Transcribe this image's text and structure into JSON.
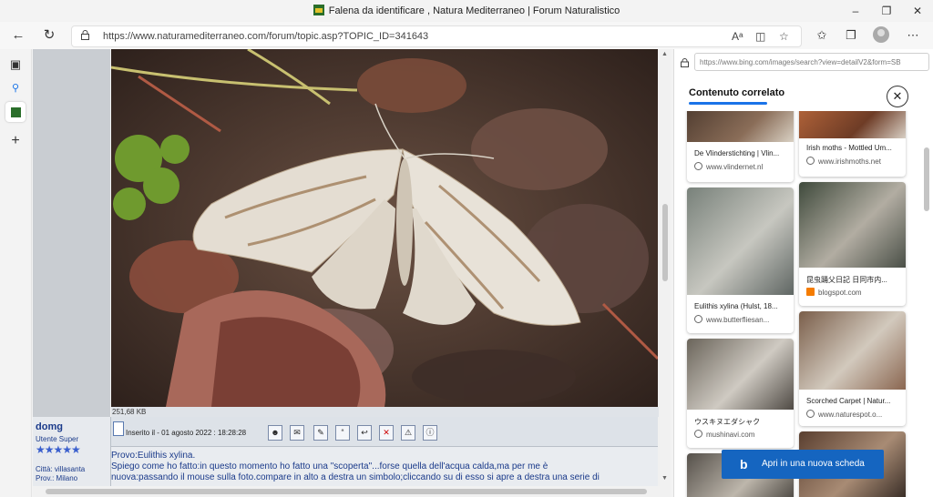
{
  "window": {
    "title": "Falena da identificare , Natura Mediterraneo | Forum Naturalistico",
    "minimize_glyph": "–",
    "maximize_glyph": "❐",
    "close_glyph": "✕"
  },
  "address_bar": {
    "url": "https://www.naturamediterraneo.com/forum/topic.asp?TOPIC_ID=341643",
    "back_glyph": "←",
    "refresh_glyph": "↻"
  },
  "post": {
    "image_size": "251,68 KB",
    "author": "domg",
    "rank": "Utente Super",
    "stars": "★★★★★",
    "city": "Città: villasanta",
    "prov": "Prov.: Milano",
    "date": "Inserito il - 01 agosto 2022 : 18:28:28",
    "body_lines": [
      "Provo:Eulithis xylina.",
      "Spiego come ho fatto:in questo momento ho fatto una \"scoperta\"...forse quella dell'acqua calda,ma per me è",
      "nuova:passando il mouse sulla foto.compare in alto a destra un simbolo;cliccando su di esso si apre a destra una serie di"
    ]
  },
  "side_pane": {
    "url": "https://www.bing.com/images/search?view=detailV2&form=SB",
    "related_title": "Contenuto correlato",
    "open_button": "Apri in una nuova scheda",
    "bing_glyph": "b",
    "cards": [
      {
        "title": "De Vlinderstichting | Vlin...",
        "source": "www.vlindernet.nl"
      },
      {
        "title": "Irish moths - Mottled Um...",
        "source": "www.irishmoths.net"
      },
      {
        "title": "Eulithis xylina (Hulst, 18...",
        "source": "www.butterfliesan..."
      },
      {
        "title": "昆虫踊父日記  日同市内...",
        "source": "blogspot.com"
      },
      {
        "title": "ウスキヌエダシャク",
        "source": "mushinavi.com"
      },
      {
        "title": "Scorched Carpet | Natur...",
        "source": "www.naturespot.o..."
      }
    ]
  },
  "colors": {
    "accent": "#1a73e8",
    "button_blue": "#1565c0",
    "forum_text": "#1a3a8a"
  }
}
